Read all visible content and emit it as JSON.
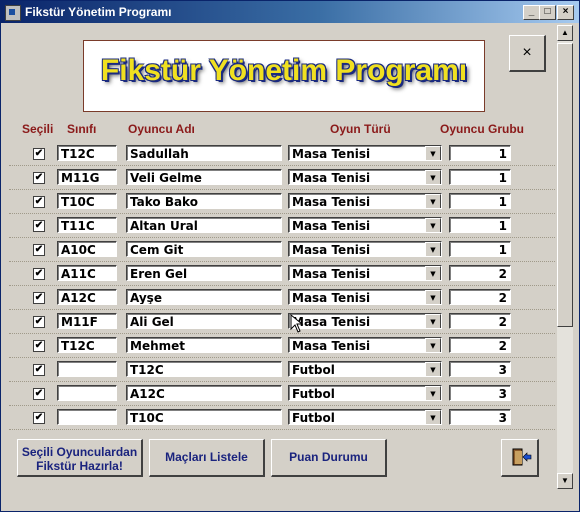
{
  "window": {
    "title": "Fikstür Yönetim Programı"
  },
  "banner": {
    "title": "Fikstür Yönetim Programı"
  },
  "close_button": {
    "label": "×"
  },
  "headers": {
    "selected": "Seçili",
    "class": "Sınıfı",
    "player": "Oyuncu Adı",
    "game_type": "Oyun Türü",
    "group": "Oyuncu Grubu"
  },
  "rows": [
    {
      "checked": "✔",
      "class": "T12C",
      "name": "Sadullah",
      "game": "Masa Tenisi",
      "group": "1"
    },
    {
      "checked": "✔",
      "class": "M11G",
      "name": "Veli Gelme",
      "game": "Masa Tenisi",
      "group": "1"
    },
    {
      "checked": "✔",
      "class": "T10C",
      "name": "Tako Bako",
      "game": "Masa Tenisi",
      "group": "1"
    },
    {
      "checked": "✔",
      "class": "T11C",
      "name": "Altan Ural",
      "game": "Masa Tenisi",
      "group": "1"
    },
    {
      "checked": "✔",
      "class": "A10C",
      "name": "Cem Git",
      "game": "Masa Tenisi",
      "group": "1"
    },
    {
      "checked": "✔",
      "class": "A11C",
      "name": "Eren Gel",
      "game": "Masa Tenisi",
      "group": "2"
    },
    {
      "checked": "✔",
      "class": "A12C",
      "name": "Ayşe",
      "game": "Masa Tenisi",
      "group": "2"
    },
    {
      "checked": "✔",
      "class": "M11F",
      "name": "Ali Gel",
      "game": "Masa Tenisi",
      "group": "2"
    },
    {
      "checked": "✔",
      "class": "T12C",
      "name": "Mehmet",
      "game": "Masa Tenisi",
      "group": "2"
    },
    {
      "checked": "✔",
      "class": "",
      "name": "T12C",
      "game": "Futbol",
      "group": "3"
    },
    {
      "checked": "✔",
      "class": "",
      "name": "A12C",
      "game": "Futbol",
      "group": "3"
    },
    {
      "checked": "✔",
      "class": "",
      "name": "T10C",
      "game": "Futbol",
      "group": "3"
    }
  ],
  "buttons": {
    "prepare_line1": "Seçili Oyunculardan",
    "prepare_line2": "Fikstür Hazırla!",
    "list_matches": "Maçları Listele",
    "standings": "Puan Durumu"
  },
  "icons": {
    "app": "access-form-icon",
    "exit": "exit-door-icon"
  },
  "colors": {
    "header_text": "#8b1a1a",
    "button_text": "#1a237e",
    "banner_fill": "#f0e020",
    "banner_outline": "#1a2a80"
  }
}
